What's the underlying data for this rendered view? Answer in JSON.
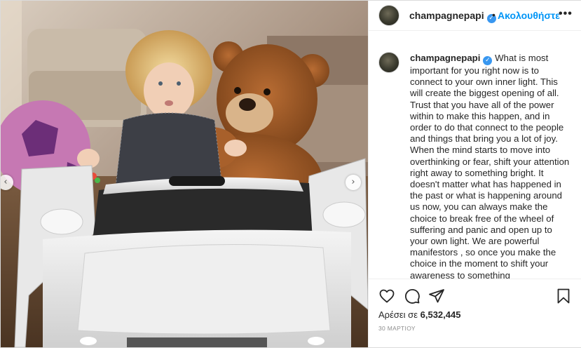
{
  "post": {
    "username": "champagnepapi",
    "verified_icon": "verified-check-icon",
    "separator": "•",
    "follow_label": "Ακολουθήστε",
    "more_icon": "more-options-icon",
    "caption_user": "champagnepapi",
    "caption": "What is most important for you right now is to connect to your own inner light. This will create the biggest opening of all. Trust that you have all of the power within to make this happen, and in order to do that connect to the people and things that bring you a lot of joy. When the mind starts to move into overthinking or fear, shift your attention right away to something bright. It doesn't matter what has happened in the past or what is happening around us now, you can always make the choice to break free of the wheel of suffering and panic and open up to your own light. We are powerful manifestors , so once you make the choice in the moment to shift your awareness to something",
    "likes_prefix": "Αρέσει σε ",
    "likes_count": "6,532,445",
    "date": "30 ΜΑΡΤΙΟΥ"
  },
  "carousel": {
    "prev_icon": "chevron-left-icon",
    "next_icon": "chevron-right-icon",
    "prev_glyph": "‹",
    "next_glyph": "›"
  },
  "actions": {
    "like_icon": "heart-icon",
    "comment_icon": "comment-icon",
    "share_icon": "share-icon",
    "save_icon": "bookmark-icon"
  },
  "colors": {
    "link_blue": "#0095f6",
    "verified_blue": "#3897f0",
    "text": "#262626",
    "muted": "#8e8e8e",
    "border": "#dbdbdb"
  }
}
